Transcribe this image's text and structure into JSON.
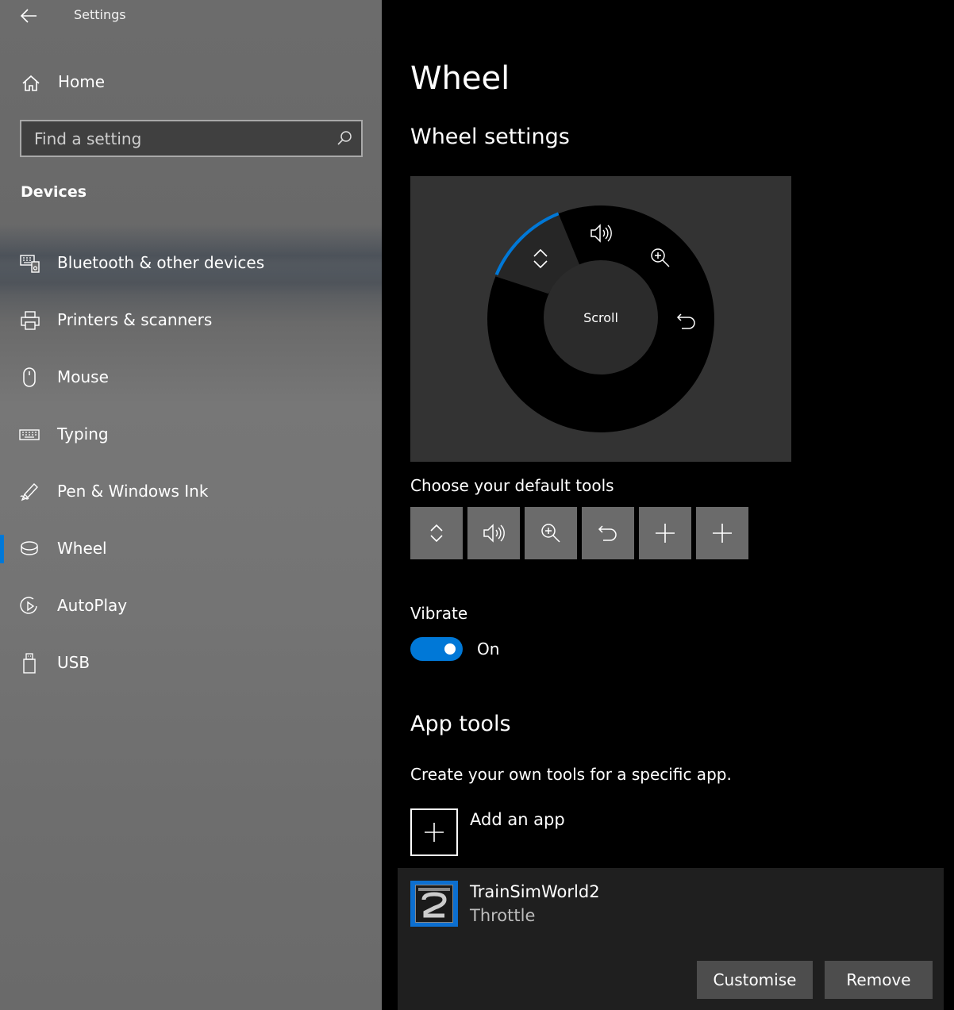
{
  "window": {
    "title": "Settings"
  },
  "sidebar": {
    "home_label": "Home",
    "search_placeholder": "Find a setting",
    "section": "Devices",
    "items": [
      {
        "label": "Bluetooth & other devices",
        "icon": "bluetooth-devices-icon"
      },
      {
        "label": "Printers & scanners",
        "icon": "printer-icon"
      },
      {
        "label": "Mouse",
        "icon": "mouse-icon"
      },
      {
        "label": "Typing",
        "icon": "keyboard-icon"
      },
      {
        "label": "Pen & Windows Ink",
        "icon": "pen-icon"
      },
      {
        "label": "Wheel",
        "icon": "wheel-icon",
        "active": true
      },
      {
        "label": "AutoPlay",
        "icon": "autoplay-icon"
      },
      {
        "label": "USB",
        "icon": "usb-icon"
      }
    ]
  },
  "main": {
    "title": "Wheel",
    "wheel_settings_heading": "Wheel settings",
    "wheel": {
      "center_label": "Scroll",
      "segments": [
        "scroll-icon",
        "volume-icon",
        "zoom-icon",
        "undo-icon"
      ]
    },
    "default_tools_label": "Choose your default tools",
    "default_tools": [
      "scroll-icon",
      "volume-icon",
      "zoom-icon",
      "undo-icon",
      "plus-icon",
      "plus-icon"
    ],
    "vibrate": {
      "label": "Vibrate",
      "state": "On",
      "on": true
    },
    "app_tools": {
      "heading": "App tools",
      "description": "Create your own tools for a specific app.",
      "add_label": "Add an app",
      "apps": [
        {
          "name": "TrainSimWorld2",
          "tool": "Throttle",
          "customise_label": "Customise",
          "remove_label": "Remove"
        }
      ]
    }
  },
  "colors": {
    "accent": "#0078d7",
    "panel": "#333333",
    "tool_button": "#6b6b6b"
  }
}
